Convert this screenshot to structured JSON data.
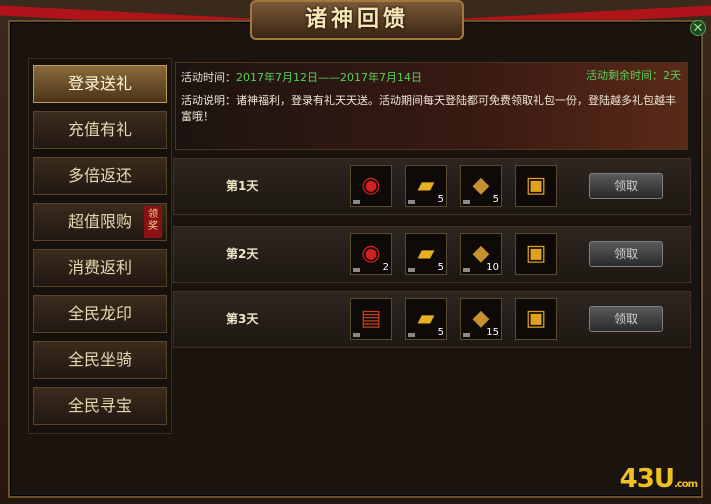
{
  "window": {
    "title": "诸神回馈",
    "close_label": "✕"
  },
  "nav": {
    "items": [
      {
        "label": "登录送礼",
        "active": true
      },
      {
        "label": "充值有礼"
      },
      {
        "label": "多倍返还"
      },
      {
        "label": "超值限购",
        "badge": "领奖"
      },
      {
        "label": "消费返利"
      },
      {
        "label": "全民龙印"
      },
      {
        "label": "全民坐骑"
      },
      {
        "label": "全民寻宝"
      }
    ]
  },
  "info": {
    "time_label": "活动时间：",
    "time_value": "2017年7月12日——2017年7月14日",
    "remain": "活动剩余时间：2天",
    "desc": "活动说明：诸神福利，登录有礼天天送。活动期间每天登陆都可免费领取礼包一份，登陆越多礼包越丰富哦！"
  },
  "rows": [
    {
      "day": "第1天",
      "rewards": [
        {
          "icon": "red-ring-icon",
          "count": ""
        },
        {
          "icon": "gold-bars-icon",
          "count": "5"
        },
        {
          "icon": "gem-badge-icon",
          "count": "5"
        },
        {
          "icon": "gift-box-icon",
          "count": ""
        }
      ],
      "button": "领取"
    },
    {
      "day": "第2天",
      "rewards": [
        {
          "icon": "red-ring-icon",
          "count": "2"
        },
        {
          "icon": "gold-bars-icon",
          "count": "5"
        },
        {
          "icon": "gem-badge-icon",
          "count": "10"
        },
        {
          "icon": "gift-box-icon",
          "count": ""
        }
      ],
      "button": "领取"
    },
    {
      "day": "第3天",
      "rewards": [
        {
          "icon": "scroll-icon",
          "count": ""
        },
        {
          "icon": "gold-bars-icon",
          "count": "5"
        },
        {
          "icon": "gem-badge-icon",
          "count": "15"
        },
        {
          "icon": "gift-box-icon",
          "count": ""
        }
      ],
      "button": "领取"
    }
  ],
  "watermark": {
    "text": "43U",
    "suffix": ".com"
  },
  "colors": {
    "accent_green": "#5ad05a",
    "ribbon_red": "#b0141a",
    "gold": "#f0c020"
  }
}
